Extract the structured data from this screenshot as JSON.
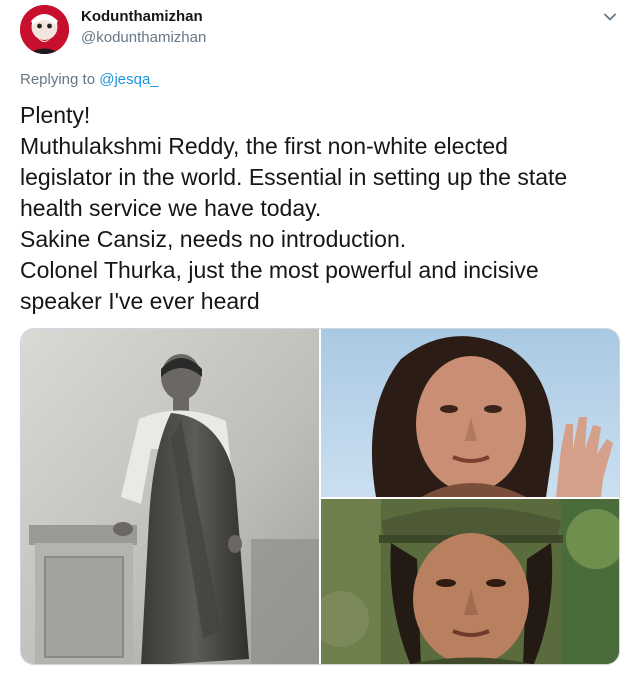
{
  "user": {
    "display_name": "Kodunthamizhan",
    "handle": "@kodunthamizhan",
    "avatar_icon": "profile-avatar"
  },
  "menu": {
    "icon": "chevron-down-icon"
  },
  "reply": {
    "prefix": "Replying to ",
    "mention": "@jesqa_"
  },
  "tweet": {
    "lines": [
      "Plenty!",
      "Muthulakshmi Reddy, the first non-white elected",
      "legislator in the world. Essential in setting up the state",
      "health service we have today.",
      "Sakine Cansiz, needs no introduction.",
      "Colonel Thurka, just the most powerful and incisive",
      "speaker I've ever heard"
    ]
  },
  "colors": {
    "text": "#14171a",
    "secondary": "#657786",
    "link": "#1b95e0",
    "border": "#ccd6dd",
    "avatar_bg": "#c8102e"
  }
}
